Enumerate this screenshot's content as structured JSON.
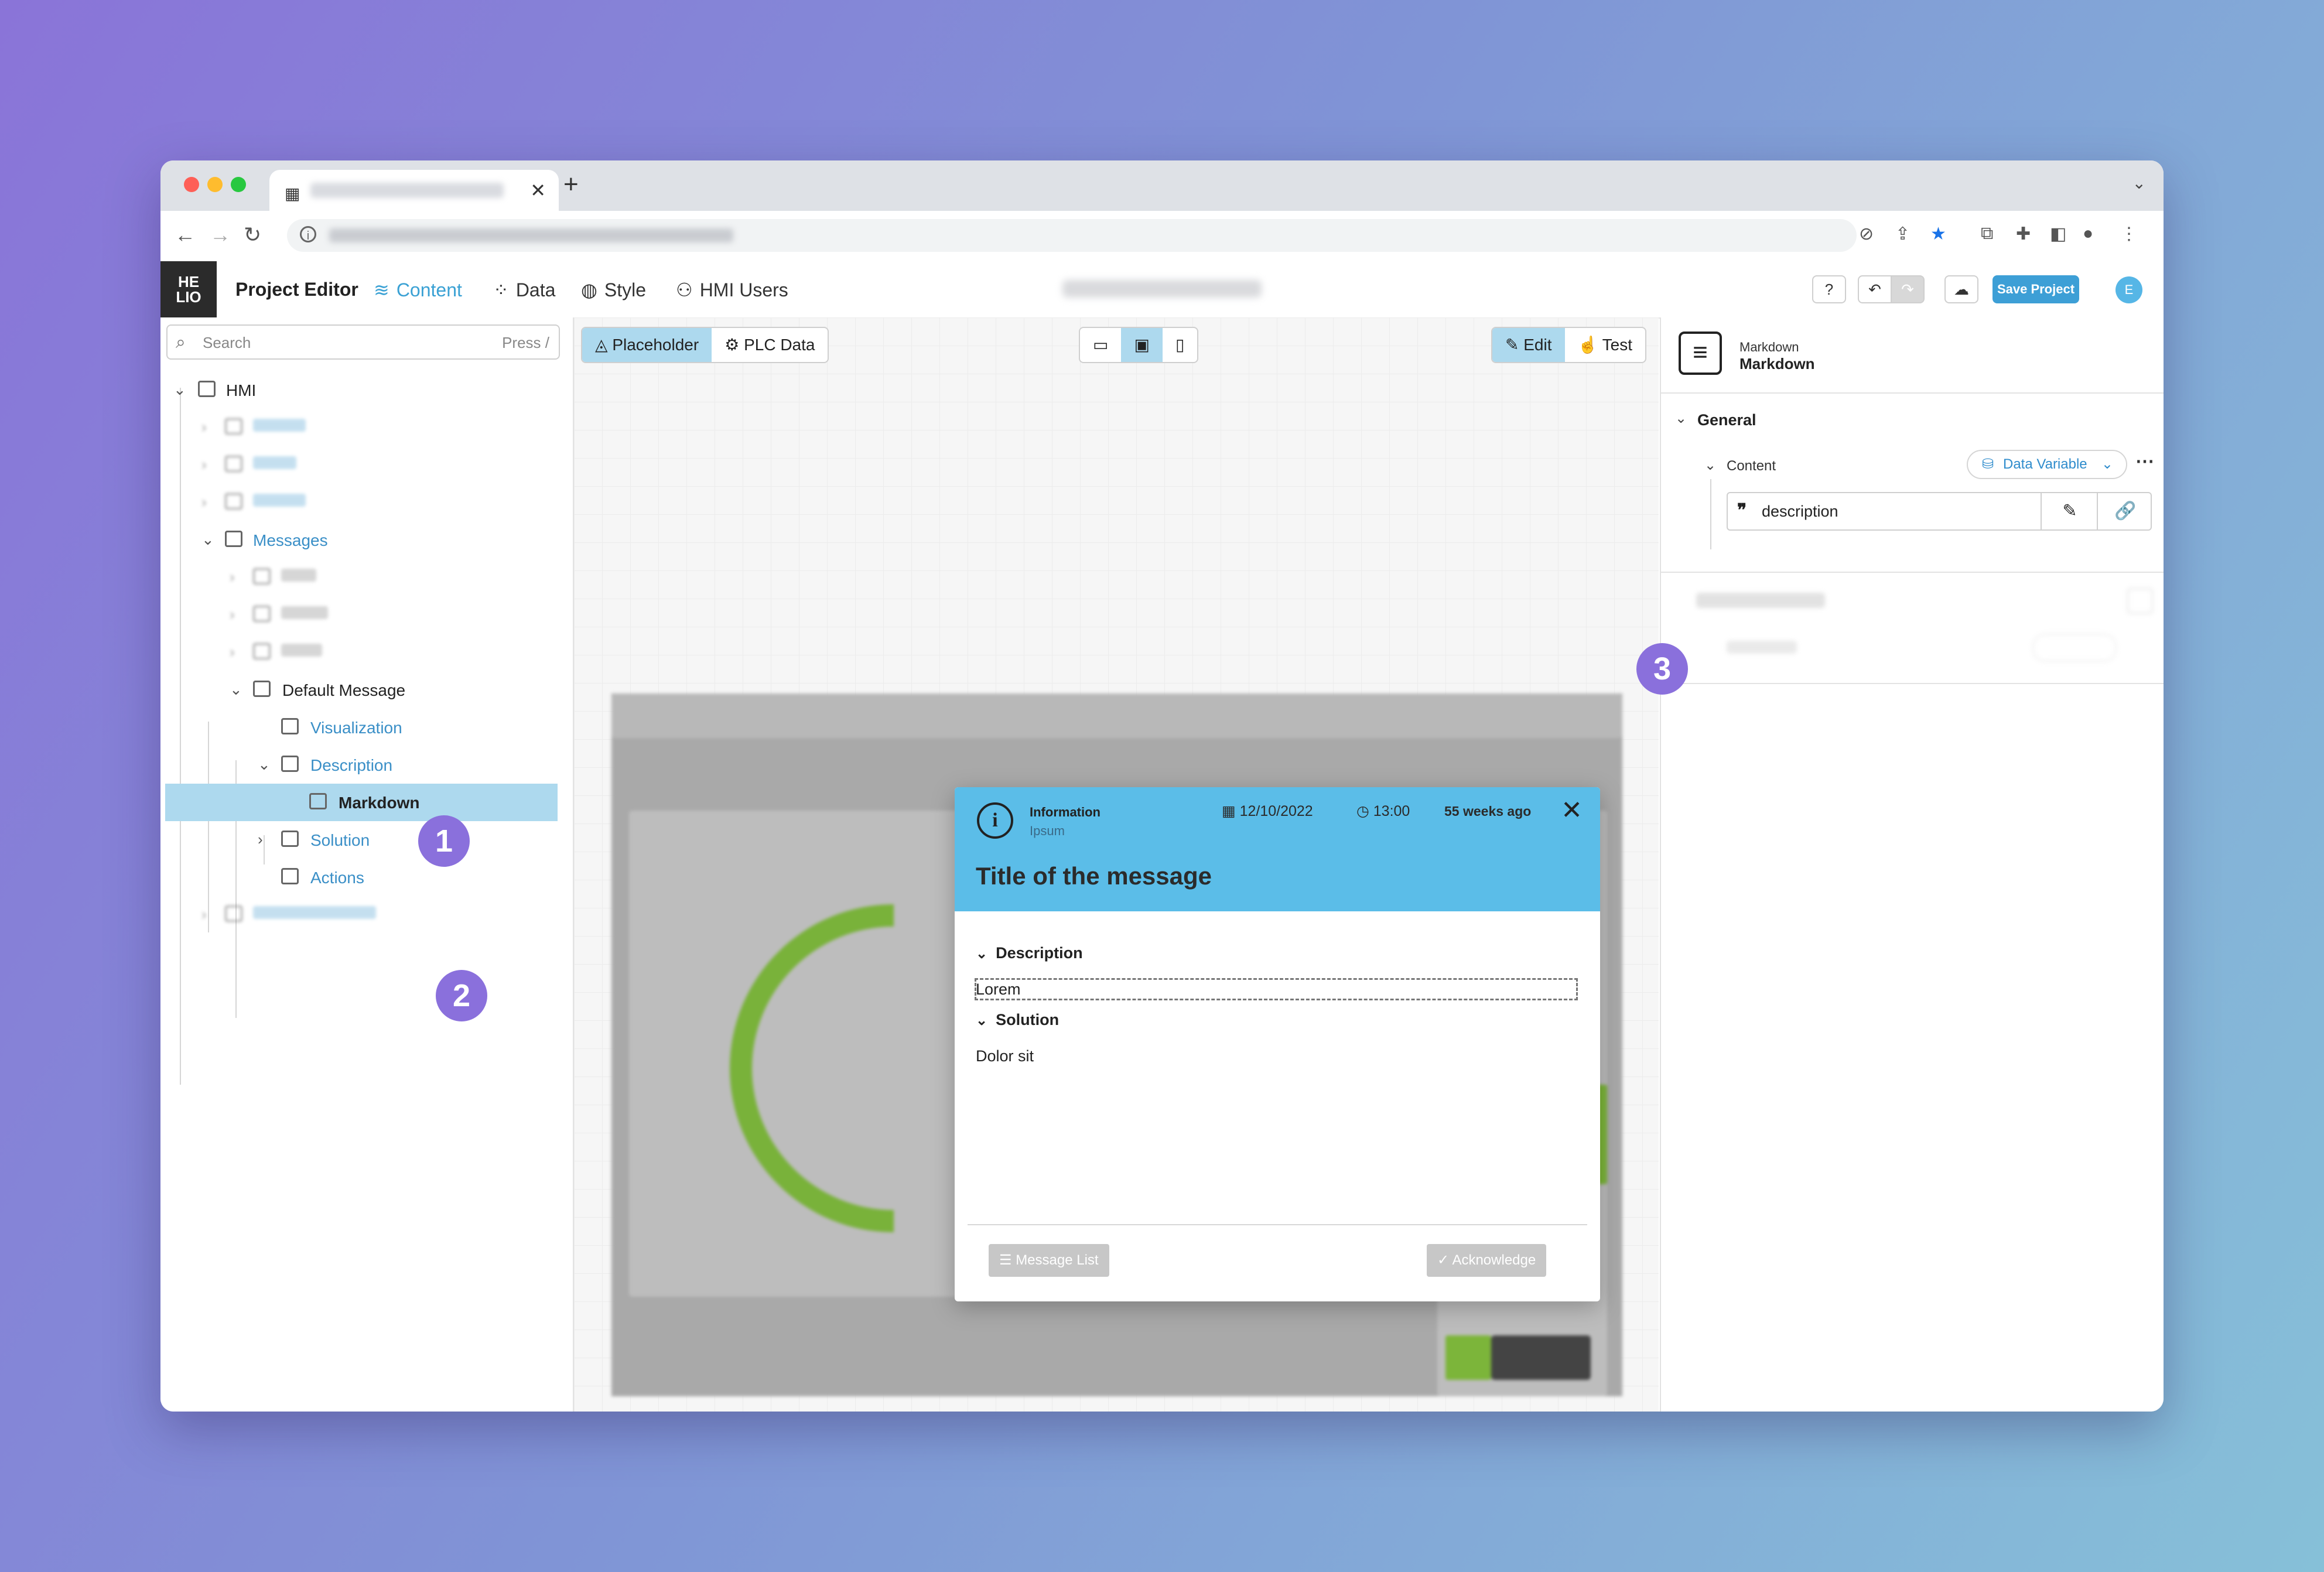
{
  "colors": {
    "accent": "#3d9fd6",
    "badge": "#8a70dc",
    "modal_header": "#5bbde8",
    "selection": "#add9ee"
  },
  "app": {
    "title": "Project Editor",
    "nav": [
      {
        "label": "Content",
        "icon": "layers-icon"
      },
      {
        "label": "Data",
        "icon": "dots-grid-icon"
      },
      {
        "label": "Style",
        "icon": "palette-icon"
      },
      {
        "label": "HMI Users",
        "icon": "users-icon"
      }
    ],
    "save_label": "Save Project",
    "avatar": "E",
    "logo": [
      "HE",
      "LIO"
    ]
  },
  "sidebar": {
    "search_placeholder": "Search",
    "search_hint": "Press /",
    "tree": {
      "root": "HMI",
      "messages": "Messages",
      "default_message": "Default Message",
      "visualization": "Visualization",
      "description": "Description",
      "markdown": "Markdown",
      "solution": "Solution",
      "actions": "Actions"
    }
  },
  "badges": [
    "1",
    "2",
    "3"
  ],
  "canvas": {
    "mode_tabs": [
      "Placeholder",
      "PLC Data"
    ],
    "edit_tabs": [
      "Edit",
      "Test"
    ]
  },
  "modal": {
    "type": "Information",
    "subtitle": "Ipsum",
    "date": "12/10/2022",
    "time": "13:00",
    "ago": "55 weeks ago",
    "title": "Title of the message",
    "description_heading": "Description",
    "description_text": "Lorem",
    "solution_heading": "Solution",
    "solution_text": "Dolor sit",
    "message_list_label": "Message List",
    "acknowledge_label": "Acknowledge"
  },
  "inspector": {
    "type": "Markdown",
    "name": "Markdown",
    "general": "General",
    "content_label": "Content",
    "binding_mode": "Data Variable",
    "field_value": "description"
  }
}
